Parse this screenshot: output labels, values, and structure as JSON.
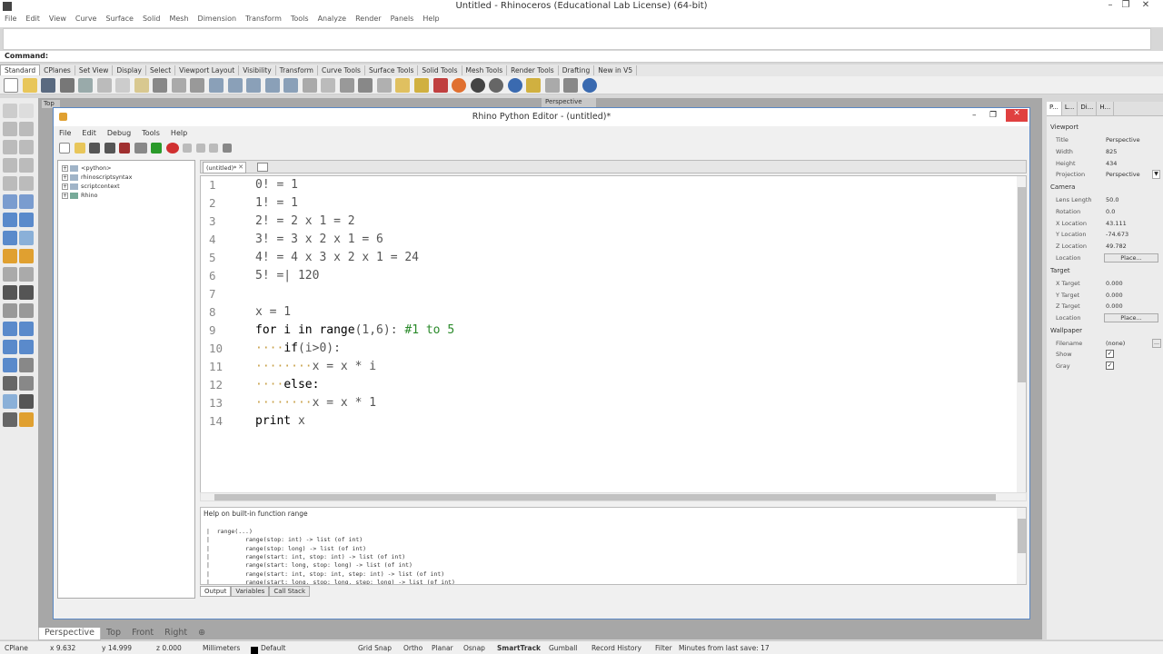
{
  "window": {
    "title": "Untitled - Rhinoceros (Educational Lab License) (64-bit)"
  },
  "menu": [
    "File",
    "Edit",
    "View",
    "Curve",
    "Surface",
    "Solid",
    "Mesh",
    "Dimension",
    "Transform",
    "Tools",
    "Analyze",
    "Render",
    "Panels",
    "Help"
  ],
  "command": {
    "label": "Command:"
  },
  "toolbar_tabs": [
    "Standard",
    "CPlanes",
    "Set View",
    "Display",
    "Select",
    "Viewport Layout",
    "Visibility",
    "Transform",
    "Curve Tools",
    "Surface Tools",
    "Solid Tools",
    "Mesh Tools",
    "Render Tools",
    "Drafting",
    "New in V5"
  ],
  "viewport": {
    "title": "Perspective",
    "top_label": "Top"
  },
  "editor": {
    "title": "Rhino Python Editor - (untitled)*",
    "menu": [
      "File",
      "Edit",
      "Debug",
      "Tools",
      "Help"
    ],
    "tree": [
      "<python>",
      "rhinoscriptsyntax",
      "scriptcontext",
      "Rhino"
    ],
    "tab": "(untitled)*",
    "code": [
      {
        "n": "1",
        "text": "0! = 1"
      },
      {
        "n": "2",
        "text": "1! = 1"
      },
      {
        "n": "3",
        "text": "2! = 2 x 1 = 2"
      },
      {
        "n": "4",
        "text": "3! = 3 x 2 x 1 = 6"
      },
      {
        "n": "5",
        "text": "4! = 4 x 3 x 2 x 1 = 24"
      },
      {
        "n": "6",
        "text": "5! =| 120"
      },
      {
        "n": "7",
        "text": ""
      },
      {
        "n": "8",
        "text": "x = 1"
      },
      {
        "n": "9",
        "kw": "for i in range",
        "rest": "(1,6): ",
        "comment": "#1 to 5"
      },
      {
        "n": "10",
        "dots": "····",
        "kw": "if",
        "rest": "(i>0):"
      },
      {
        "n": "11",
        "dots": "········",
        "rest": "x = x * i"
      },
      {
        "n": "12",
        "dots": "····",
        "kw": "else:",
        "rest": ""
      },
      {
        "n": "13",
        "dots": "········",
        "rest": "x = x * 1"
      },
      {
        "n": "14",
        "kw": "print",
        "rest": " x"
      }
    ],
    "help_title": "Help on built-in function range",
    "help_lines": [
      "|  range(...)",
      "|          range(stop: int) -> list (of int)",
      "|          range(stop: long) -> list (of int)",
      "|          range(start: int, stop: int) -> list (of int)",
      "|          range(start: long, stop: long) -> list (of int)",
      "|          range(start: int, stop: int, step: int) -> list (of int)",
      "|          range(start: long, stop: long, step: long) -> list (of int)"
    ],
    "output_tabs": [
      "Output",
      "Variables",
      "Call Stack"
    ]
  },
  "panel": {
    "tabs": [
      "P...",
      "L...",
      "Di...",
      "H..."
    ],
    "viewport_section": "Viewport",
    "title_label": "Title",
    "title_value": "Perspective",
    "width_label": "Width",
    "width_value": "825",
    "height_label": "Height",
    "height_value": "434",
    "projection_label": "Projection",
    "projection_value": "Perspective",
    "camera_section": "Camera",
    "lens_label": "Lens Length",
    "lens_value": "50.0",
    "rotation_label": "Rotation",
    "rotation_value": "0.0",
    "xloc_label": "X Location",
    "xloc_value": "43.111",
    "yloc_label": "Y Location",
    "yloc_value": "-74.673",
    "zloc_label": "Z Location",
    "zloc_value": "49.782",
    "location_label": "Location",
    "place_button": "Place...",
    "target_section": "Target",
    "xt_label": "X Target",
    "xt_value": "0.000",
    "yt_label": "Y Target",
    "yt_value": "0.000",
    "zt_label": "Z Target",
    "zt_value": "0.000",
    "tlocation_label": "Location",
    "tplace_button": "Place...",
    "wallpaper_section": "Wallpaper",
    "filename_label": "Filename",
    "filename_value": "(none)",
    "show_label": "Show",
    "gray_label": "Gray"
  },
  "viewport_tabs": [
    "Perspective",
    "Top",
    "Front",
    "Right"
  ],
  "status": {
    "cplane": "CPlane",
    "x": "x 9.632",
    "y": "y 14.999",
    "z": "z 0.000",
    "units": "Millimeters",
    "layer": "Default",
    "items": [
      "Grid Snap",
      "Ortho",
      "Planar",
      "Osnap",
      "SmartTrack",
      "Gumball",
      "Record History",
      "Filter",
      "Minutes from last save: 17"
    ]
  }
}
